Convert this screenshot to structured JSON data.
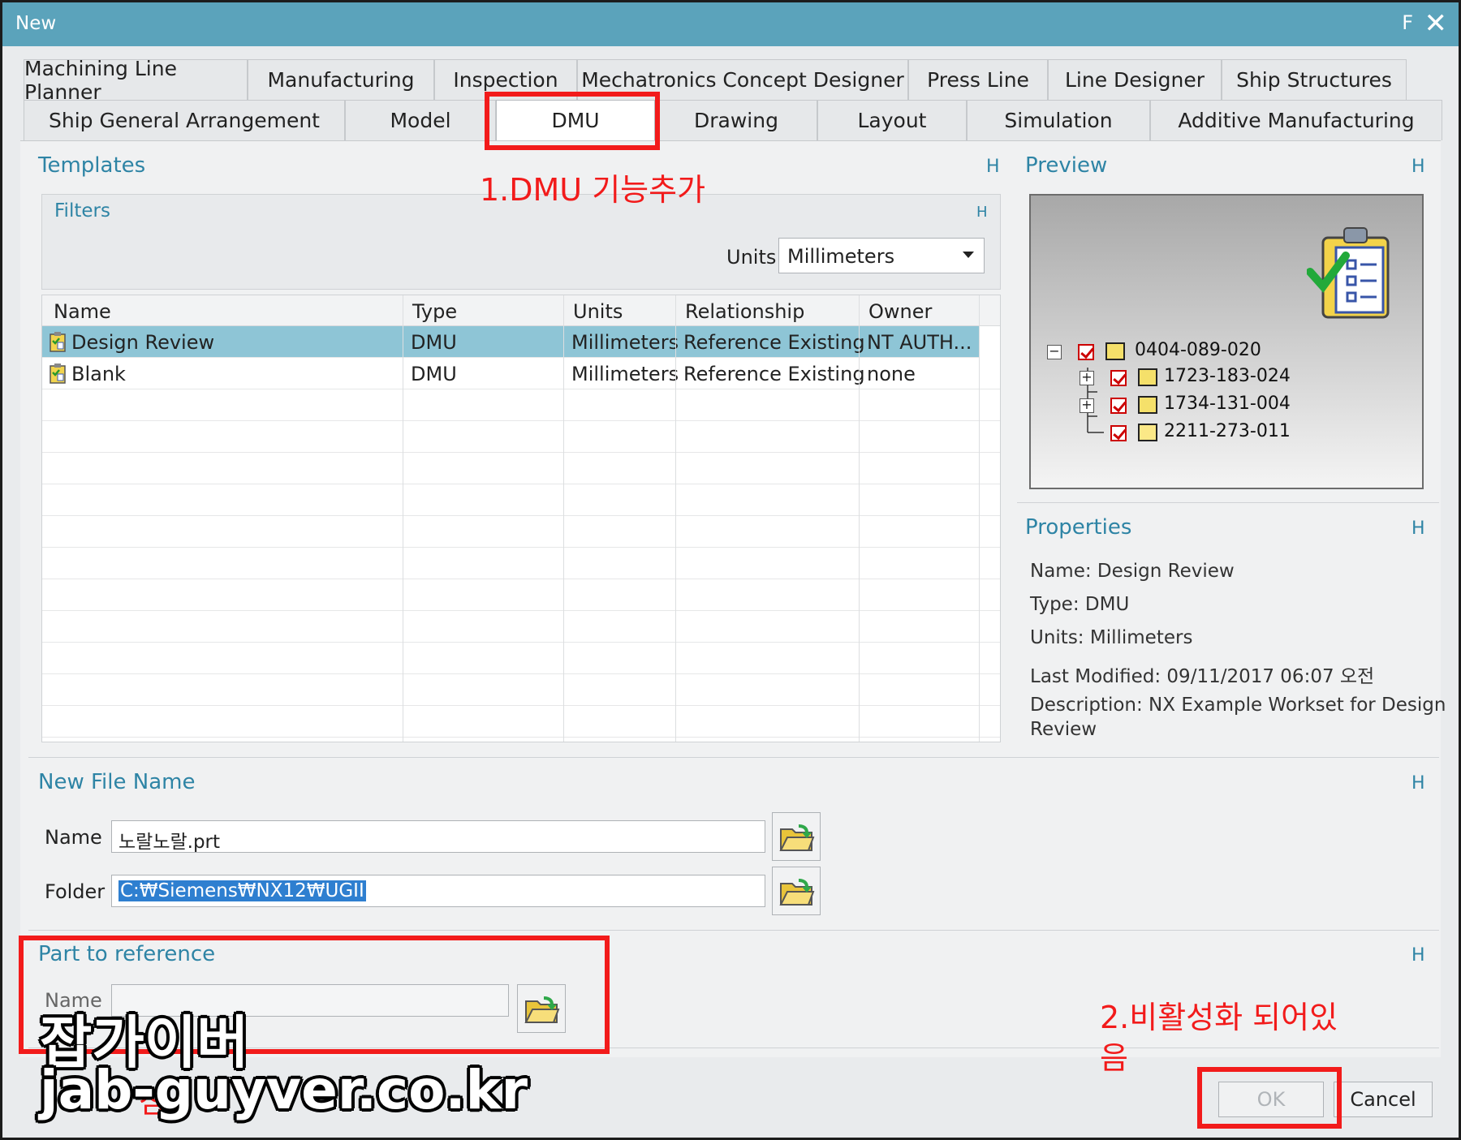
{
  "window": {
    "title": "New",
    "title_f": "F",
    "close": "✕"
  },
  "tabs_row1": [
    "Machining Line Planner",
    "Manufacturing",
    "Inspection",
    "Mechatronics Concept Designer",
    "Press Line",
    "Line Designer",
    "Ship Structures"
  ],
  "tabs_row2": [
    "Ship General Arrangement",
    "Model",
    "DMU",
    "Drawing",
    "Layout",
    "Simulation",
    "Additive Manufacturing"
  ],
  "active_tab": "DMU",
  "templates": {
    "title": "Templates",
    "hide": "H",
    "filters": {
      "title": "Filters",
      "hide": "H",
      "units_label": "Units",
      "units_value": "Millimeters"
    },
    "columns": [
      "Name",
      "Type",
      "Units",
      "Relationship",
      "Owner"
    ],
    "rows": [
      {
        "name": "Design Review",
        "type": "DMU",
        "units": "Millimeters",
        "relationship": "Reference Existing",
        "owner": "NT AUTH...",
        "selected": true
      },
      {
        "name": "Blank",
        "type": "DMU",
        "units": "Millimeters",
        "relationship": "Reference Existing",
        "owner": "none",
        "selected": false
      }
    ]
  },
  "preview": {
    "title": "Preview",
    "hide": "H",
    "tree": [
      "0404-089-020",
      "1723-183-024",
      "1734-131-004",
      "2211-273-011"
    ]
  },
  "properties": {
    "title": "Properties",
    "hide": "H",
    "name": "Name: Design Review",
    "type": "Type: DMU",
    "units": "Units: Millimeters",
    "modified": "Last Modified: 09/11/2017 06:07 오전",
    "description_1": "Description: NX Example Workset for Design",
    "description_2": "Review"
  },
  "new_file": {
    "title": "New File Name",
    "hide": "H",
    "name_label": "Name",
    "name_value": "노랄노랄.prt",
    "folder_label": "Folder",
    "folder_value": "C:₩Siemens₩NX12₩UGII"
  },
  "part_ref": {
    "title": "Part to reference",
    "hide": "H",
    "name_label": "Name",
    "name_value": ""
  },
  "buttons": {
    "ok": "OK",
    "cancel": "Cancel"
  },
  "annotations": {
    "step1": "1.DMU 기능추가",
    "step2_line1": "2.비활성화 되어있",
    "step2_line2": "음",
    "partial_red": "참"
  },
  "watermark": {
    "line1": "잡가이버",
    "line2": "jab-guyver.co.kr"
  },
  "colors": {
    "accent": "#2e84a5",
    "titlebar": "#5ba3bb",
    "selection": "#8ec5d6",
    "annotation": "#f21b1b"
  }
}
